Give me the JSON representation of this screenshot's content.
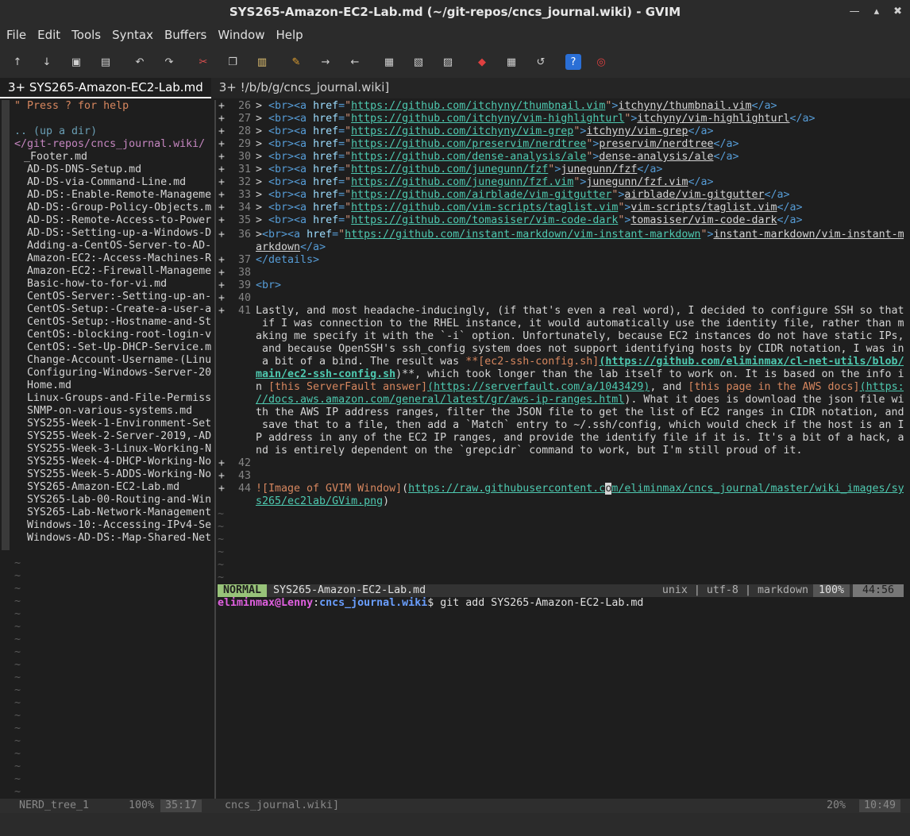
{
  "window": {
    "title": "SYS265-Amazon-EC2-Lab.md (~/git-repos/cncs_journal.wiki) - GVIM",
    "controls": [
      "minimize",
      "maximize",
      "close"
    ]
  },
  "menu": [
    "File",
    "Edit",
    "Tools",
    "Syntax",
    "Buffers",
    "Window",
    "Help"
  ],
  "toolbar": {
    "icons": [
      "open-icon",
      "save-icon",
      "save-all-icon",
      "print-icon",
      "undo-icon",
      "redo-icon",
      "cut-icon",
      "copy-icon",
      "paste-icon",
      "find-replace-icon",
      "find-next-icon",
      "find-prev-icon",
      "load-session-icon",
      "save-session-icon",
      "run-script-icon",
      "make-icon",
      "shell-icon",
      "tags-icon",
      "help-icon",
      "find-help-icon"
    ]
  },
  "tabs": [
    {
      "label": "3+ SYS265-Amazon-EC2-Lab.md",
      "active": true
    },
    {
      "label": "3+ !/b/b/g/cncs_journal.wiki]",
      "active": false
    }
  ],
  "nerdtree": {
    "help": "\" Press ? for help",
    "up": ".. (up a dir)",
    "root": "</git-repos/cncs_journal.wiki/",
    "files": [
      "_Footer.md",
      "AD-DS-DNS-Setup.md",
      "AD-DS-via-Command-Line.md",
      "AD-DS:-Enable-Remote-Manageme",
      "AD-DS:-Group-Policy-Objects.m",
      "AD-DS:-Remote-Access-to-Power",
      "AD-DS:-Setting-up-a-Windows-D",
      "Adding-a-CentOS-Server-to-AD-",
      "Amazon-EC2:-Access-Machines-R",
      "Amazon-EC2:-Firewall-Manageme",
      "Basic-how-to-for-vi.md",
      "CentOS-Server:-Setting-up-an-",
      "CentOS-Setup:-Create-a-user-a",
      "CentOS-Setup:-Hostname-and-St",
      "CentOS:-blocking-root-login-v",
      "CentOS:-Set-Up-DHCP-Service.m",
      "Change-Account-Username-(Linu",
      "Configuring-Windows-Server-20",
      "Home.md",
      "Linux-Groups-and-File-Permiss",
      "SNMP-on-various-systems.md",
      "SYS255-Week-1-Environment-Set",
      "SYS255-Week-2-Server-2019,-AD",
      "SYS255-Week-3-Linux-Working-N",
      "SYS255-Week-4-DHCP-Working-No",
      "SYS255-Week-5-ADDS-Working-No",
      "SYS265-Amazon-EC2-Lab.md",
      "SYS265-Lab-00-Routing-and-Win",
      "SYS265-Lab-Network-Management",
      "Windows-10:-Accessing-IPv4-Se",
      "Windows-AD-DS:-Map-Shared-Net"
    ]
  },
  "editor": {
    "list_lines": [
      {
        "n": "26",
        "url": "https://github.com/itchyny/thumbnail.vim",
        "text": "itchyny/thumbnail.vim"
      },
      {
        "n": "27",
        "url": "https://github.com/itchyny/vim-highlighturl",
        "text": "itchyny/vim-highlighturl"
      },
      {
        "n": "28",
        "url": "https://github.com/itchyny/vim-grep",
        "text": "itchyny/vim-grep"
      },
      {
        "n": "29",
        "url": "https://github.com/preservim/nerdtree",
        "text": "preservim/nerdtree"
      },
      {
        "n": "30",
        "url": "https://github.com/dense-analysis/ale",
        "text": "dense-analysis/ale"
      },
      {
        "n": "31",
        "url": "https://github.com/junegunn/fzf",
        "text": "junegunn/fzf"
      },
      {
        "n": "32",
        "url": "https://github.com/junegunn/fzf.vim",
        "text": "junegunn/fzf.vim"
      },
      {
        "n": "33",
        "url": "https://github.com/airblade/vim-gitgutter",
        "text": "airblade/vim-gitgutter"
      },
      {
        "n": "34",
        "url": "https://github.com/vim-scripts/taglist.vim",
        "text": "vim-scripts/taglist.vim"
      },
      {
        "n": "35",
        "url": "https://github.com/tomasiser/vim-code-dark",
        "text": "tomasiser/vim-code-dark"
      }
    ],
    "l36_num": "36",
    "l36_url": "https://github.com/instant-markdown/vim-instant-markdown",
    "l36_text_a": "instant-markdown/vim-instant-m",
    "l36_text_b": "arkdown",
    "l37_num": "37",
    "l37": "</details>",
    "l38_num": "38",
    "l39_num": "39",
    "l39": "<br>",
    "l40_num": "40",
    "l41_num": "41",
    "p41": [
      "Lastly, and most headache-inducingly, (if that's even a real word), I decided to configure SSH so that",
      " if I was connection to the RHEL instance, it would automatically use the identity file, rather than m",
      "aking me specify it with the `-i` option. Unfortunately, because EC2 instances do not have static IPs,",
      " and because OpenSSH's ssh_config system does not support identifying hosts by CIDR notation, I was in",
      " a bit of a bind. The result was "
    ],
    "p41_link1_label": "**[ec2-ssh-config.sh]",
    "p41_link1_url_a": "(https://github.com/eliminmax/cl-net-utils/blob/",
    "p41_link1_url_b": "main/ec2-ssh-config.sh",
    "p41_after_link1": ")**, which took longer than the lab itself to work on. It is based on the info i",
    "p41_line7_a": "n ",
    "p41_link2_label": "[this ServerFault answer]",
    "p41_link2_url": "(https://serverfault.com/a/1043429)",
    "p41_line7_mid": ", and ",
    "p41_link3_label": "[this page in the AWS docs]",
    "p41_link3_url_a": "(https:",
    "p41_link3_url_b": "//docs.aws.amazon.com/general/latest/gr/aws-ip-ranges.html",
    "p41_line8_after": "). What it does is download the json file wi",
    "p41_rest": [
      "th the AWS IP address ranges, filter the JSON file to get the list of EC2 ranges in CIDR notation, and",
      " save that to a file, then add a `Match` entry to ~/.ssh/config, which would check if the host is an I",
      "P address in any of the EC2 IP ranges, and provide the identify file if it is. It's a bit of a hack, a",
      "nd is entirely dependent on the `grepcidr` command to work, but I'm still proud of it."
    ],
    "l42_num": "42",
    "l43_num": "43",
    "l44_num": "44",
    "l44_alt": "![Image of GVIM Window]",
    "l44_url_a": "https://raw.githubusercontent.c",
    "l44_cursor": "o",
    "l44_url_b": "m/eliminmax/cncs_journal/master/wiki_images/sy",
    "l44_url_c": "s265/ec2lab/GVim.png",
    "tilde": "~"
  },
  "statusline": {
    "mode": "NORMAL",
    "file": "SYS265-Amazon-EC2-Lab.md",
    "info": "unix | utf-8 | markdown",
    "percent": "100%",
    "position": "44:56"
  },
  "terminal": {
    "user": "eliminmax@Lenny",
    "sep": ":",
    "path": "cncs_journal.wiki",
    "prompt": "$ ",
    "command": "git add SYS265-Amazon-EC2-Lab.md"
  },
  "bottom_status": {
    "nt_name": "NERD_tree_1",
    "nt_pct": "100%",
    "nt_pos": "35:17",
    "term_name": "cncs_journal.wiki]",
    "term_pct": "20%",
    "term_pos": "10:49"
  }
}
